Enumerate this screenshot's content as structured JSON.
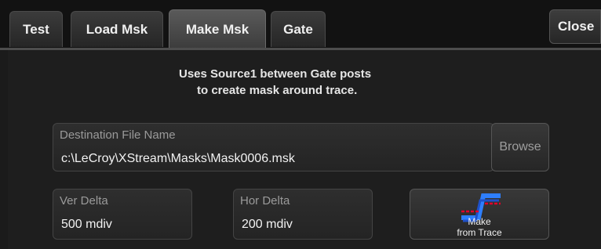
{
  "tabs": [
    {
      "label": "Test",
      "active": false
    },
    {
      "label": "Load Msk",
      "active": false
    },
    {
      "label": "Make Msk",
      "active": true
    },
    {
      "label": "Gate",
      "active": false
    }
  ],
  "close_label": "Close",
  "instructions": {
    "line1": "Uses Source1 between Gate posts",
    "line2": "to create mask around trace."
  },
  "destination": {
    "label": "Destination File Name",
    "value": "c:\\LeCroy\\XStream\\Masks\\Mask0006.msk",
    "browse_label": "Browse"
  },
  "ver_delta": {
    "label": "Ver Delta",
    "value": "500 mdiv"
  },
  "hor_delta": {
    "label": "Hor Delta",
    "value": "200 mdiv"
  },
  "make_button": {
    "line1": "Make",
    "line2": "from Trace",
    "icon": "mask-trace-icon"
  },
  "colors": {
    "background": "#1b1b1b",
    "icon_trace": "#2e7fff",
    "icon_mask": "#e0002a"
  }
}
